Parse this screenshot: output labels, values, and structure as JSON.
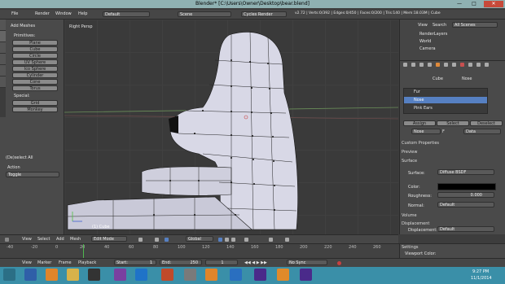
{
  "window": {
    "title": "Blender* [C:\\Users\\Owner\\Desktop\\bear.blend]",
    "min": "—",
    "max": "□",
    "close": "✕"
  },
  "infobar": {
    "menus": [
      "File",
      "Render",
      "Window",
      "Help"
    ],
    "layout": "Default",
    "scene": "Scene",
    "engine": "Cycles Render",
    "stats": "v2.72 | Verts:0/392 | Edges:0/450 | Faces:0/200 | Tris:140 | Mem:18.03M | Cube"
  },
  "toolshelf": {
    "tabs": [
      "Tools",
      "Create",
      "Relations",
      "Animation",
      "Physics",
      "Grease Pencil"
    ],
    "header": "Add Meshes",
    "primitives_label": "Primitives:",
    "primitives": [
      "Plane",
      "Cube",
      "Circle",
      "UV Sphere",
      "Ico Sphere",
      "Cylinder",
      "Cone",
      "Torus"
    ],
    "special_label": "Special:",
    "special": [
      "Grid",
      "Monkey"
    ],
    "operator_header": "(De)select All",
    "action_label": "Action",
    "action_value": "Toggle"
  },
  "viewport": {
    "view_label": "Right Persp",
    "object_label": "(1) Cube"
  },
  "viewport_header": {
    "menus": [
      "View",
      "Select",
      "Add",
      "Mesh"
    ],
    "mode": "Edit Mode",
    "orientation": "Global"
  },
  "outliner": {
    "menus": [
      "View",
      "Search"
    ],
    "scenes": "All Scenes",
    "items": [
      "RenderLayers",
      "World",
      "Camera"
    ]
  },
  "properties": {
    "breadcrumb_obj": "Cube",
    "breadcrumb_mat": "Nose",
    "materials": [
      "Fur",
      "Nose",
      "Pink Ears"
    ],
    "selected_material": "Nose",
    "buttons": [
      "Assign",
      "Select",
      "Deselect"
    ],
    "mat_name": "Nose",
    "mat_f": "F",
    "data": "Data",
    "panels": [
      "Custom Properties",
      "Preview"
    ],
    "surface_header": "Surface",
    "surface_label": "Surface:",
    "surface_value": "Diffuse BSDF",
    "color_label": "Color:",
    "roughness_label": "Roughness:",
    "roughness_value": "0.000",
    "normal_label": "Normal:",
    "normal_value": "Default",
    "volume_header": "Volume",
    "displacement_header": "Displacement",
    "displacement_label": "Displacement:",
    "displacement_value": "Default",
    "settings_header": "Settings",
    "viewport_color_label": "Viewport Color:"
  },
  "timeline": {
    "ticks": [
      "-40",
      "-20",
      "0",
      "20",
      "40",
      "60",
      "80",
      "100",
      "120",
      "140",
      "160",
      "180",
      "200",
      "220",
      "240",
      "260"
    ],
    "menus": [
      "View",
      "Marker",
      "Frame",
      "Playback"
    ],
    "start": "Start:",
    "start_val": "1",
    "end": "End:",
    "end_val": "250",
    "current": "1",
    "sync": "No Sync"
  },
  "taskbar": {
    "time": "9:27 PM",
    "date": "11/1/2014"
  },
  "colors": {
    "mesh": "#d8d8e6",
    "selected": "#5680c2",
    "titlebar": "#8fb1b2",
    "taskbar": "#3a8fa8"
  }
}
